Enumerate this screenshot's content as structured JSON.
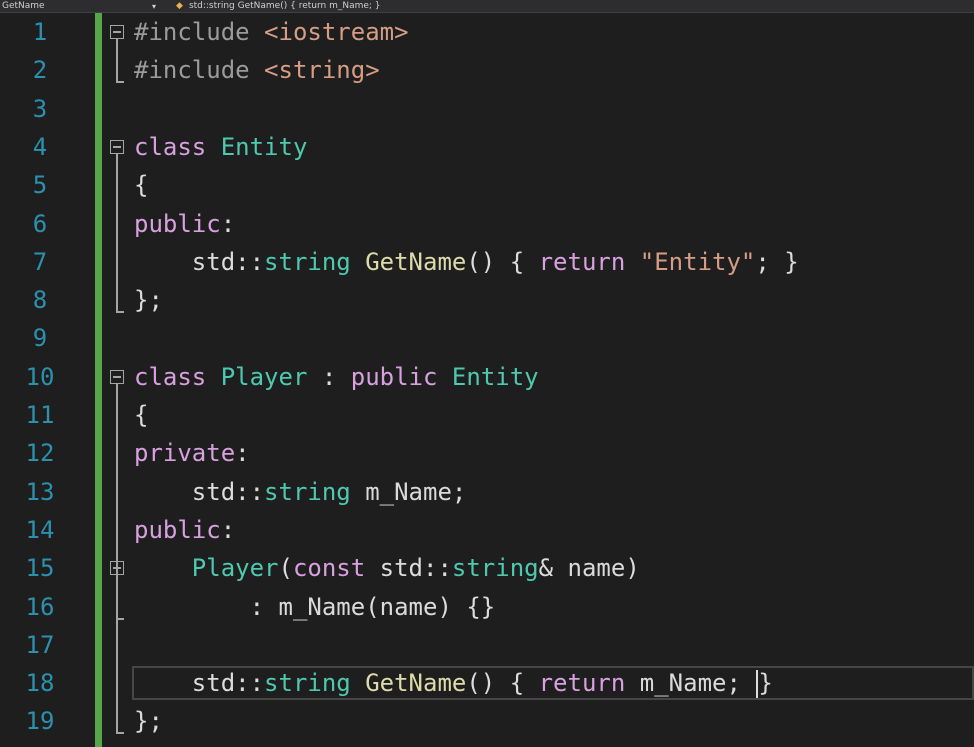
{
  "topbar": {
    "left_scope": "GetName",
    "member_text": "std::string GetName() { return m_Name; }"
  },
  "editor": {
    "line_numbers": [
      "1",
      "2",
      "3",
      "4",
      "5",
      "6",
      "7",
      "8",
      "9",
      "10",
      "11",
      "12",
      "13",
      "14",
      "15",
      "16",
      "17",
      "18",
      "19"
    ],
    "lines": [
      [
        {
          "c": "pre",
          "t": "#include"
        },
        {
          "c": "p",
          "t": " "
        },
        {
          "c": "s",
          "t": "<iostream>"
        }
      ],
      [
        {
          "c": "pre",
          "t": "#include"
        },
        {
          "c": "p",
          "t": " "
        },
        {
          "c": "s",
          "t": "<string>"
        }
      ],
      [],
      [
        {
          "c": "k",
          "t": "class"
        },
        {
          "c": "p",
          "t": " "
        },
        {
          "c": "t",
          "t": "Entity"
        }
      ],
      [
        {
          "c": "p",
          "t": "{"
        }
      ],
      [
        {
          "c": "k",
          "t": "public"
        },
        {
          "c": "p",
          "t": ":"
        }
      ],
      [
        {
          "c": "p",
          "t": "    std::"
        },
        {
          "c": "t",
          "t": "string"
        },
        {
          "c": "p",
          "t": " "
        },
        {
          "c": "f",
          "t": "GetName"
        },
        {
          "c": "p",
          "t": "() { "
        },
        {
          "c": "k",
          "t": "return"
        },
        {
          "c": "p",
          "t": " "
        },
        {
          "c": "s",
          "t": "\"Entity\""
        },
        {
          "c": "p",
          "t": "; }"
        }
      ],
      [
        {
          "c": "p",
          "t": "};"
        }
      ],
      [],
      [
        {
          "c": "k",
          "t": "class"
        },
        {
          "c": "p",
          "t": " "
        },
        {
          "c": "t",
          "t": "Player"
        },
        {
          "c": "p",
          "t": " : "
        },
        {
          "c": "k",
          "t": "public"
        },
        {
          "c": "p",
          "t": " "
        },
        {
          "c": "t",
          "t": "Entity"
        }
      ],
      [
        {
          "c": "p",
          "t": "{"
        }
      ],
      [
        {
          "c": "k",
          "t": "private"
        },
        {
          "c": "p",
          "t": ":"
        }
      ],
      [
        {
          "c": "p",
          "t": "    std::"
        },
        {
          "c": "t",
          "t": "string"
        },
        {
          "c": "p",
          "t": " "
        },
        {
          "c": "m",
          "t": "m_Name"
        },
        {
          "c": "p",
          "t": ";"
        }
      ],
      [
        {
          "c": "k",
          "t": "public"
        },
        {
          "c": "p",
          "t": ":"
        }
      ],
      [
        {
          "c": "p",
          "t": "    "
        },
        {
          "c": "t",
          "t": "Player"
        },
        {
          "c": "p",
          "t": "("
        },
        {
          "c": "k",
          "t": "const"
        },
        {
          "c": "p",
          "t": " std::"
        },
        {
          "c": "t",
          "t": "string"
        },
        {
          "c": "p",
          "t": "& "
        },
        {
          "c": "m",
          "t": "name"
        },
        {
          "c": "p",
          "t": ")"
        }
      ],
      [
        {
          "c": "p",
          "t": "        : "
        },
        {
          "c": "m",
          "t": "m_Name"
        },
        {
          "c": "p",
          "t": "("
        },
        {
          "c": "m",
          "t": "name"
        },
        {
          "c": "p",
          "t": ") {}"
        }
      ],
      [],
      [
        {
          "c": "p",
          "t": "    std::"
        },
        {
          "c": "t",
          "t": "string"
        },
        {
          "c": "p",
          "t": " "
        },
        {
          "c": "f",
          "t": "GetName"
        },
        {
          "c": "p",
          "t": "() { "
        },
        {
          "c": "k",
          "t": "return"
        },
        {
          "c": "p",
          "t": " "
        },
        {
          "c": "m",
          "t": "m_Name"
        },
        {
          "c": "p",
          "t": "; "
        },
        {
          "c": "p",
          "t": "}"
        }
      ],
      [
        {
          "c": "p",
          "t": "};"
        }
      ]
    ],
    "current_line": 18,
    "folded_regions": [
      "1-2",
      "4-8",
      "10-19",
      "15-16"
    ]
  },
  "colors": {
    "background": "#1e1e1e",
    "line_number": "#2b91af",
    "change_bar": "#57a64a",
    "keyword": "#d8a0df",
    "type": "#4ec9b0",
    "function": "#dcdcaa",
    "string": "#d69d85"
  }
}
